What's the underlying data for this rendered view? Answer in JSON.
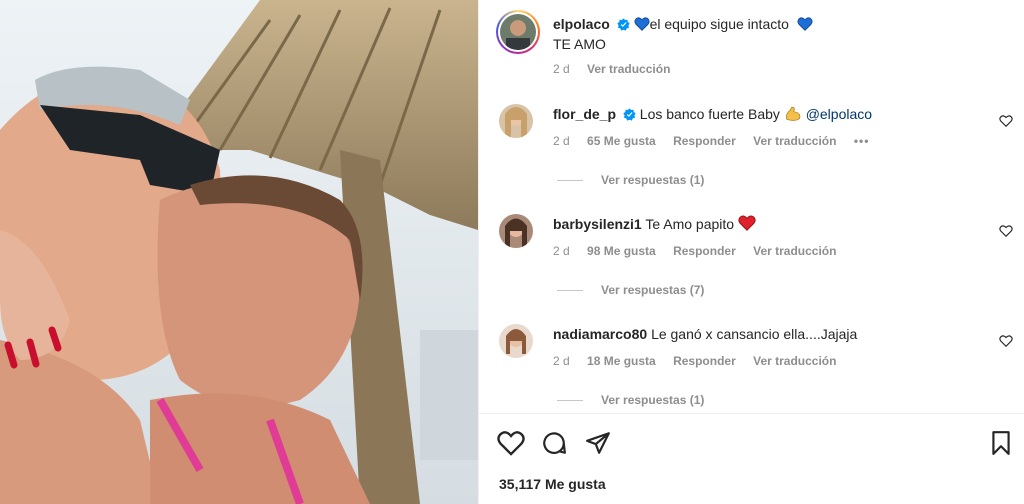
{
  "post": {
    "owner": "elpolaco",
    "caption_line1": "el equipo sigue intacto",
    "caption_line2": "TE AMO",
    "time": "2 d",
    "see_translation": "Ver traducción"
  },
  "comments": [
    {
      "user": "flor_de_p",
      "verified": true,
      "text": "Los banco fuerte Baby",
      "emoji": "flexed-biceps",
      "mention": "@elpolaco",
      "time": "2 d",
      "likes": "65 Me gusta",
      "reply": "Responder",
      "translate": "Ver traducción",
      "more": "•••",
      "replies": "Ver respuestas (1)"
    },
    {
      "user": "barbysilenzi1",
      "verified": false,
      "text": "Te Amo papito",
      "emoji": "red-heart",
      "time": "2 d",
      "likes": "98 Me gusta",
      "reply": "Responder",
      "translate": "Ver traducción",
      "replies": "Ver respuestas (7)"
    },
    {
      "user": "nadiamarco80",
      "verified": false,
      "text": "Le ganó x cansancio ella....Jajaja",
      "time": "2 d",
      "likes": "18 Me gusta",
      "reply": "Responder",
      "translate": "Ver traducción",
      "replies": "Ver respuestas (1)"
    }
  ],
  "likes_count": "35,117 Me gusta",
  "colors": {
    "verified_blue": "#0095f6",
    "mention": "#00376b",
    "secondary": "#8e8e8e",
    "heart_red": "#e0202a",
    "heart_blue": "#1d6fd8"
  }
}
